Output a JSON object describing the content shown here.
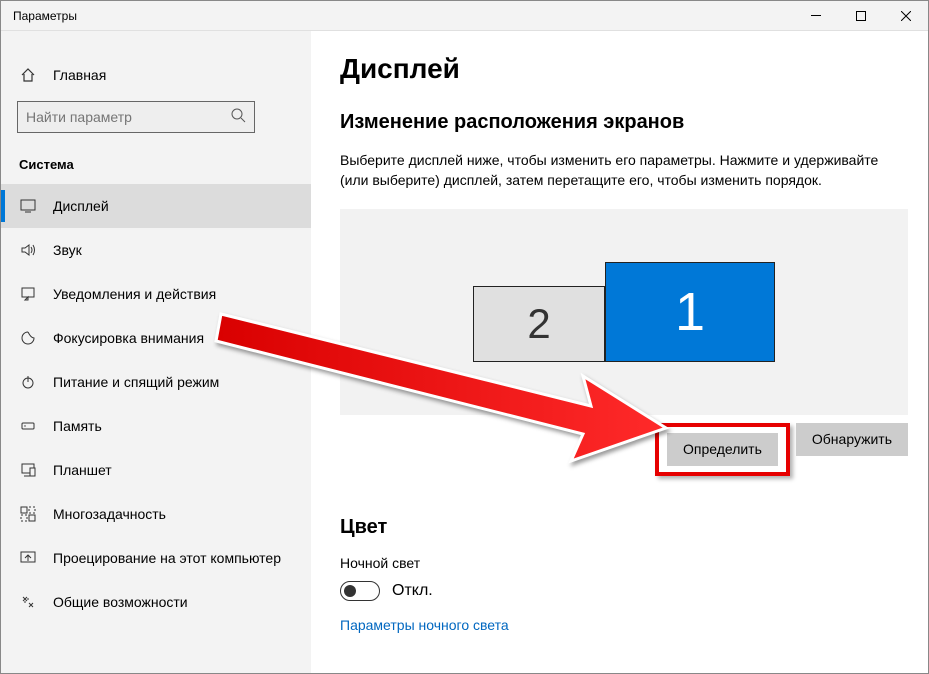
{
  "window": {
    "title": "Параметры"
  },
  "sidebar": {
    "home": "Главная",
    "search_placeholder": "Найти параметр",
    "section": "Система",
    "items": [
      {
        "label": "Дисплей",
        "active": true
      },
      {
        "label": "Звук"
      },
      {
        "label": "Уведомления и действия"
      },
      {
        "label": "Фокусировка внимания"
      },
      {
        "label": "Питание и спящий режим"
      },
      {
        "label": "Память"
      },
      {
        "label": "Планшет"
      },
      {
        "label": "Многозадачность"
      },
      {
        "label": "Проецирование на этот компьютер"
      },
      {
        "label": "Общие возможности"
      }
    ]
  },
  "main": {
    "title": "Дисплей",
    "arrange_title": "Изменение расположения экранов",
    "arrange_desc": "Выберите дисплей ниже, чтобы изменить его параметры. Нажмите и удерживайте (или выберите) дисплей, затем перетащите его, чтобы изменить порядок.",
    "monitors": {
      "secondary": "2",
      "primary": "1"
    },
    "identify_btn": "Определить",
    "detect_btn": "Обнаружить",
    "color_title": "Цвет",
    "night_light_label": "Ночной свет",
    "toggle_state": "Откл.",
    "night_light_link": "Параметры ночного света"
  }
}
